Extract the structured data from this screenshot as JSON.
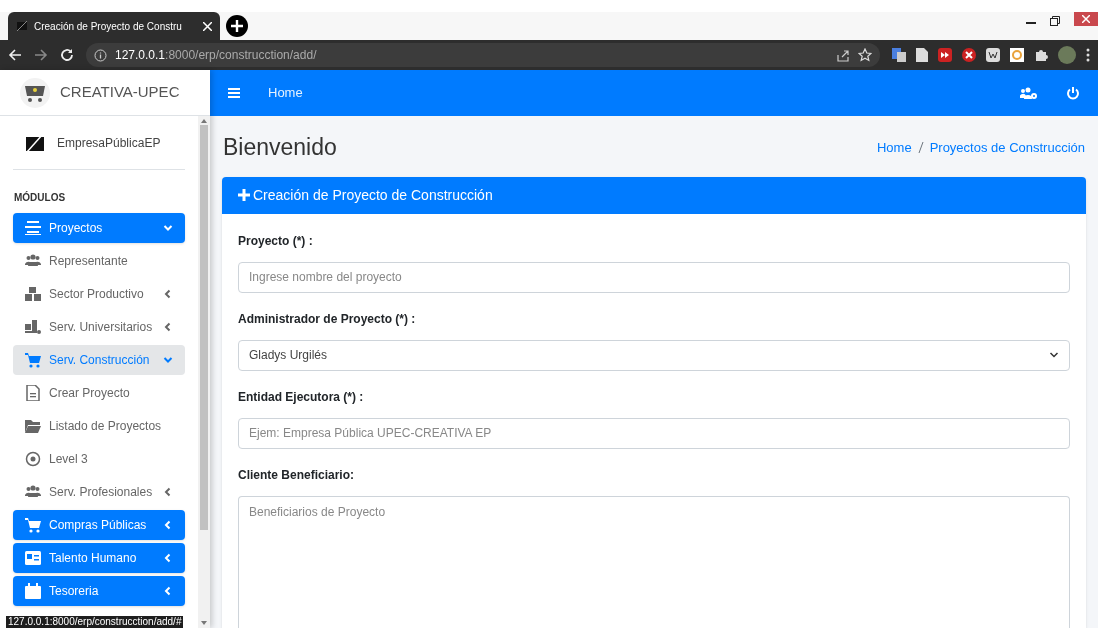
{
  "browser": {
    "tab_title": "Creación de Proyecto de Constru",
    "url_host": "127.0.0.1",
    "url_path": ":8000/erp/construcction/add/",
    "status_url": "127.0.0.1:8000/erp/construcction/add/#"
  },
  "brand": "CREATIVA-UPEC",
  "navbar": {
    "link": "Home"
  },
  "sidebar": {
    "user": "EmpresaPúblicaEP",
    "section": "MÓDULOS",
    "items": [
      {
        "kind": "module",
        "label": "Proyectos",
        "expanded": true
      },
      {
        "kind": "link",
        "label": "Representante"
      },
      {
        "kind": "group",
        "label": "Sector Productivo",
        "expanded": false,
        "selected": false
      },
      {
        "kind": "group",
        "label": "Serv. Universitarios",
        "expanded": false,
        "selected": false
      },
      {
        "kind": "group",
        "label": "Serv. Construcción",
        "expanded": true,
        "selected": true
      },
      {
        "kind": "link",
        "label": "Crear Proyecto"
      },
      {
        "kind": "link",
        "label": "Listado de Proyectos"
      },
      {
        "kind": "link",
        "label": "Level 3"
      },
      {
        "kind": "group",
        "label": "Serv. Profesionales",
        "expanded": false,
        "selected": false
      },
      {
        "kind": "module",
        "label": "Compras Públicas",
        "expanded": false
      },
      {
        "kind": "module",
        "label": "Talento Humano",
        "expanded": false
      },
      {
        "kind": "module",
        "label": "Tesoreria",
        "expanded": false
      }
    ]
  },
  "page": {
    "title": "Bienvenido",
    "breadcrumb": [
      "Home",
      "Proyectos de Construcción"
    ]
  },
  "card": {
    "title": "Creación de Proyecto de Construcción",
    "fields": [
      {
        "kind": "input",
        "label": "Proyecto (*) :",
        "placeholder": "Ingrese nombre del proyecto"
      },
      {
        "kind": "select",
        "label": "Administrador de Proyecto (*) :",
        "value": "Gladys Urgilés"
      },
      {
        "kind": "input",
        "label": "Entidad Ejecutora (*) :",
        "placeholder": "Ejem: Empresa Pública UPEC-CREATIVA EP"
      },
      {
        "kind": "textarea",
        "label": "Cliente Beneficiario:",
        "placeholder": "Beneficiarios de Proyecto"
      }
    ]
  }
}
